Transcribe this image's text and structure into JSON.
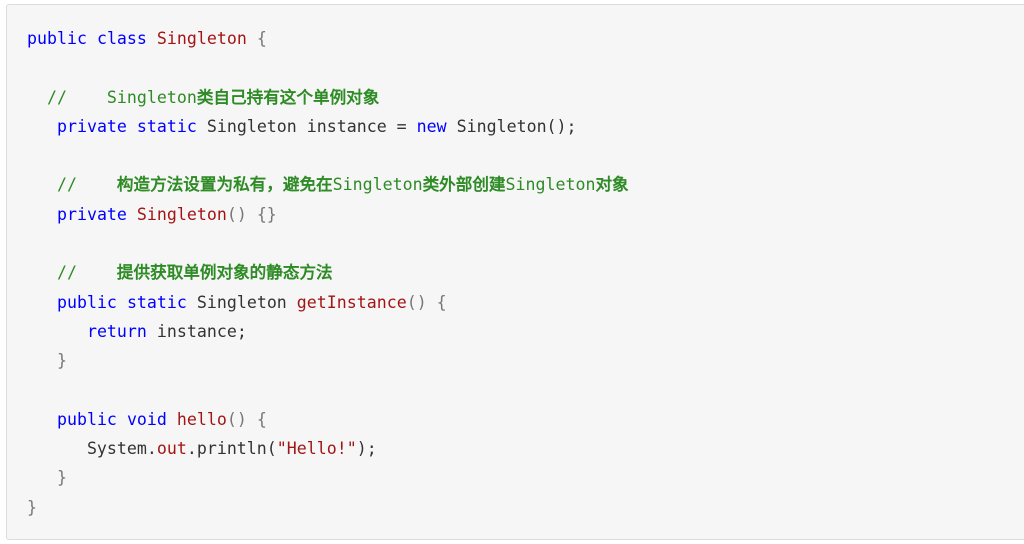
{
  "code": {
    "language": "java",
    "lines": [
      [
        {
          "t": "public",
          "k": "keyword"
        },
        {
          "t": " ",
          "k": "plain"
        },
        {
          "t": "class",
          "k": "keyword"
        },
        {
          "t": " ",
          "k": "plain"
        },
        {
          "t": "Singleton",
          "k": "name"
        },
        {
          "t": " {",
          "k": "punct"
        }
      ],
      [],
      [
        {
          "t": "  //    Singleton",
          "k": "comment"
        },
        {
          "t": "类自己持有这个单例对象",
          "k": "comment-cjk"
        }
      ],
      [
        {
          "t": "   ",
          "k": "plain"
        },
        {
          "t": "private",
          "k": "keyword"
        },
        {
          "t": " ",
          "k": "plain"
        },
        {
          "t": "static",
          "k": "keyword"
        },
        {
          "t": " Singleton instance = ",
          "k": "plain"
        },
        {
          "t": "new",
          "k": "keyword"
        },
        {
          "t": " Singleton();",
          "k": "plain"
        }
      ],
      [],
      [
        {
          "t": "   //    ",
          "k": "comment"
        },
        {
          "t": "构造方法设置为私有，避免在",
          "k": "comment-cjk"
        },
        {
          "t": "Singleton",
          "k": "comment"
        },
        {
          "t": "类外部创建",
          "k": "comment-cjk"
        },
        {
          "t": "Singleton",
          "k": "comment"
        },
        {
          "t": "对象",
          "k": "comment-cjk"
        }
      ],
      [
        {
          "t": "   ",
          "k": "plain"
        },
        {
          "t": "private",
          "k": "keyword"
        },
        {
          "t": " ",
          "k": "plain"
        },
        {
          "t": "Singleton",
          "k": "name"
        },
        {
          "t": "() {}",
          "k": "punct"
        }
      ],
      [],
      [
        {
          "t": "   //    ",
          "k": "comment"
        },
        {
          "t": "提供获取单例对象的静态方法",
          "k": "comment-cjk"
        }
      ],
      [
        {
          "t": "   ",
          "k": "plain"
        },
        {
          "t": "public",
          "k": "keyword"
        },
        {
          "t": " ",
          "k": "plain"
        },
        {
          "t": "static",
          "k": "keyword"
        },
        {
          "t": " Singleton ",
          "k": "plain"
        },
        {
          "t": "getInstance",
          "k": "name"
        },
        {
          "t": "() {",
          "k": "punct"
        }
      ],
      [
        {
          "t": "      ",
          "k": "plain"
        },
        {
          "t": "return",
          "k": "keyword"
        },
        {
          "t": " instance;",
          "k": "plain"
        }
      ],
      [
        {
          "t": "   }",
          "k": "punct"
        }
      ],
      [],
      [
        {
          "t": "   ",
          "k": "plain"
        },
        {
          "t": "public",
          "k": "keyword"
        },
        {
          "t": " ",
          "k": "plain"
        },
        {
          "t": "void",
          "k": "keyword"
        },
        {
          "t": " ",
          "k": "plain"
        },
        {
          "t": "hello",
          "k": "name"
        },
        {
          "t": "() {",
          "k": "punct"
        }
      ],
      [
        {
          "t": "      System.",
          "k": "plain"
        },
        {
          "t": "out",
          "k": "member"
        },
        {
          "t": ".println(",
          "k": "plain"
        },
        {
          "t": "\"Hello!\"",
          "k": "string"
        },
        {
          "t": ");",
          "k": "plain"
        }
      ],
      [
        {
          "t": "   }",
          "k": "punct"
        }
      ],
      [
        {
          "t": "}",
          "k": "punct"
        }
      ]
    ]
  }
}
